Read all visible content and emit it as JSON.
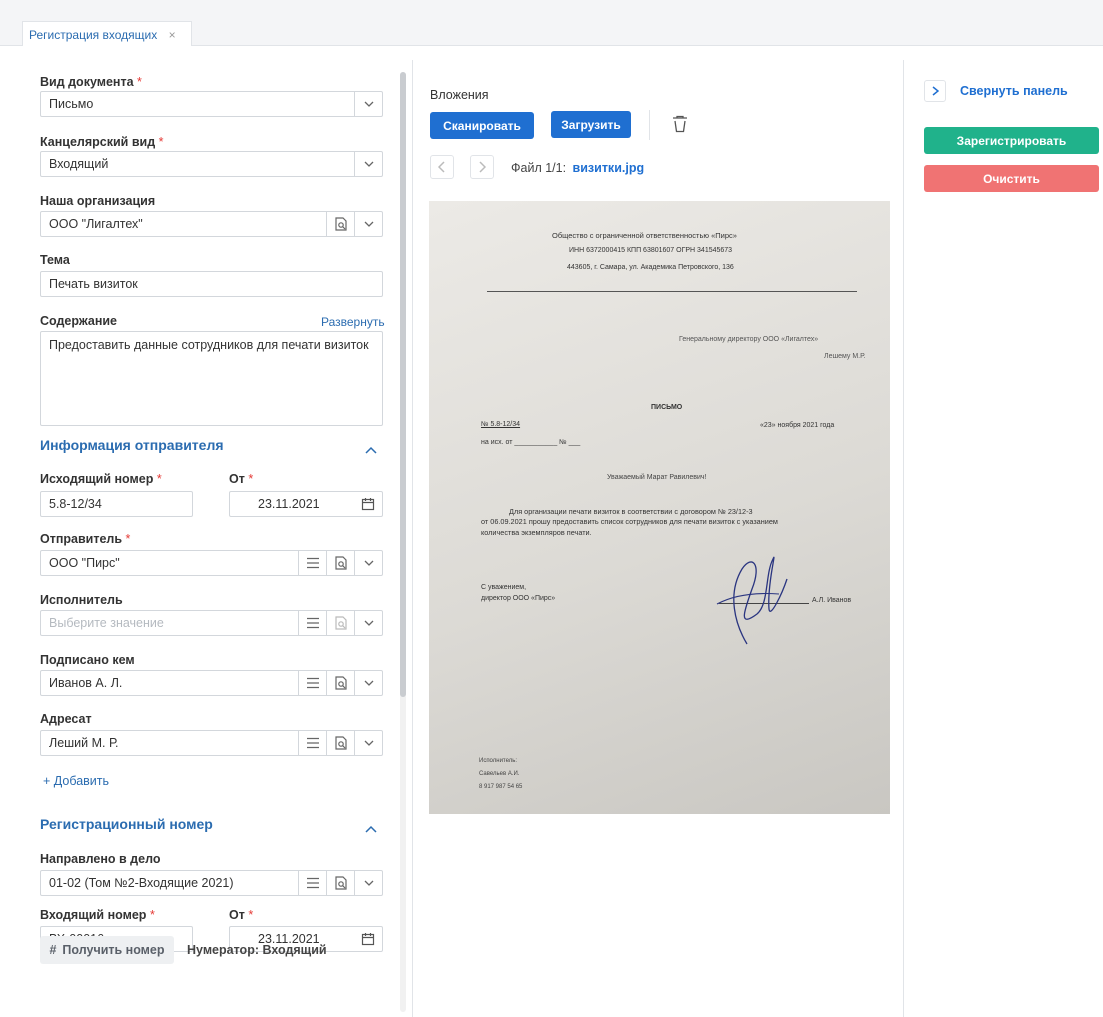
{
  "tab": {
    "label": "Регистрация входящих",
    "close": "×"
  },
  "form": {
    "doc_type": {
      "label": "Вид документа",
      "req": "*",
      "value": "Письмо"
    },
    "office_type": {
      "label": "Канцелярский вид",
      "req": "*",
      "value": "Входящий"
    },
    "our_org": {
      "label": "Наша организация",
      "value": "ООО \"Лигалтех\""
    },
    "subject": {
      "label": "Тема",
      "value": "Печать визиток"
    },
    "content": {
      "label": "Содержание",
      "expand": "Развернуть",
      "value": "Предоставить данные сотрудников для печати визиток"
    },
    "sender_section": "Информация отправителя",
    "out_number": {
      "label": "Исходящий номер",
      "req": "*",
      "value": "5.8-12/34"
    },
    "out_date": {
      "label": "От",
      "req": "*",
      "value": "23.11.2021"
    },
    "sender": {
      "label": "Отправитель",
      "req": "*",
      "value": "ООО \"Пирс\""
    },
    "executor": {
      "label": "Исполнитель",
      "placeholder": "Выберите значение"
    },
    "signed_by": {
      "label": "Подписано кем",
      "value": "Иванов А. Л."
    },
    "addressee": {
      "label": "Адресат",
      "value": "Леший М. Р."
    },
    "add": "+ Добавить",
    "reg_section": "Регистрационный номер",
    "sent_to_case": {
      "label": "Направлено в дело",
      "value": "01-02 (Том №2-Входящие 2021)"
    },
    "in_number": {
      "label": "Входящий номер",
      "req": "*",
      "value": "ВХ-00016"
    },
    "in_date": {
      "label": "От",
      "req": "*",
      "value": "23.11.2021"
    },
    "get_number": "Получить номер",
    "numerator": "Нумератор: Входящий"
  },
  "attachments": {
    "title": "Вложения",
    "scan": "Сканировать",
    "upload": "Загрузить",
    "file_counter": "Файл 1/1:",
    "file_name": "визитки.jpg"
  },
  "letter": {
    "org": "Общество с ограниченной ответственностью «Пирс»",
    "ids": "ИНН 6372000415 КПП 63801607 ОГРН 341545673",
    "addr": "443605, г. Самара, ул. Академика Петровского, 136",
    "to1": "Генеральному директору ООО «Лигалтех»",
    "to2": "Лешему М.Р.",
    "heading": "ПИСЬМО",
    "num": "№ 5.8-12/34",
    "date": "«23» ноября 2021 года",
    "ref": "на исх. от ___________ № ___",
    "greet": "Уважаемый Марат Равилевич!",
    "body1": "Для организации печати визиток в соответствии с договором № 23/12-3",
    "body2": "от 06.09.2021 прошу предоставить список сотрудников для печати визиток с указанием",
    "body3": "количества экземпляров печати.",
    "sign1": "С уважением,",
    "sign2": "директор ООО «Пирс»",
    "signer": "А.Л. Иванов",
    "exec1": "Исполнитель:",
    "exec2": "Савельев А.И.",
    "exec3": "8 917 987 54 65"
  },
  "right_panel": {
    "collapse": "Свернуть панель",
    "register": "Зарегистрировать",
    "clear": "Очистить"
  },
  "colors": {
    "accent": "#1f6fd1",
    "green": "#20b28b",
    "red": "#f07373"
  }
}
